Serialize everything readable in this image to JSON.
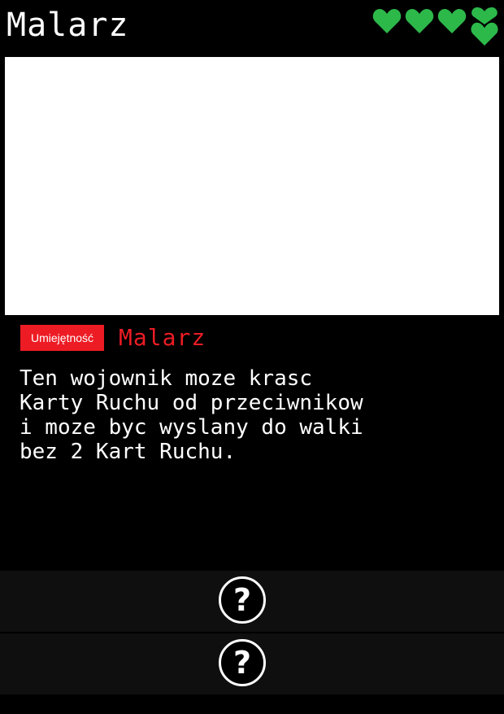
{
  "card": {
    "title": "Malarz",
    "hearts": {
      "count": 4,
      "color": "#2db84a",
      "last_variant": "stacked"
    },
    "art_background": "#ffffff",
    "ability": {
      "label": "Umiejętność",
      "name": "Malarz",
      "accent_color": "#ed1c24"
    },
    "description_lines": [
      "Ten wojownik moze krasc",
      "Karty Ruchu od przeciwnikow",
      "i moze byc wyslany do walki",
      "bez 2 Kart Ruchu."
    ]
  },
  "actions": [
    {
      "icon": "question-circle-icon",
      "glyph": "?"
    },
    {
      "icon": "question-circle-icon",
      "glyph": "?"
    }
  ]
}
